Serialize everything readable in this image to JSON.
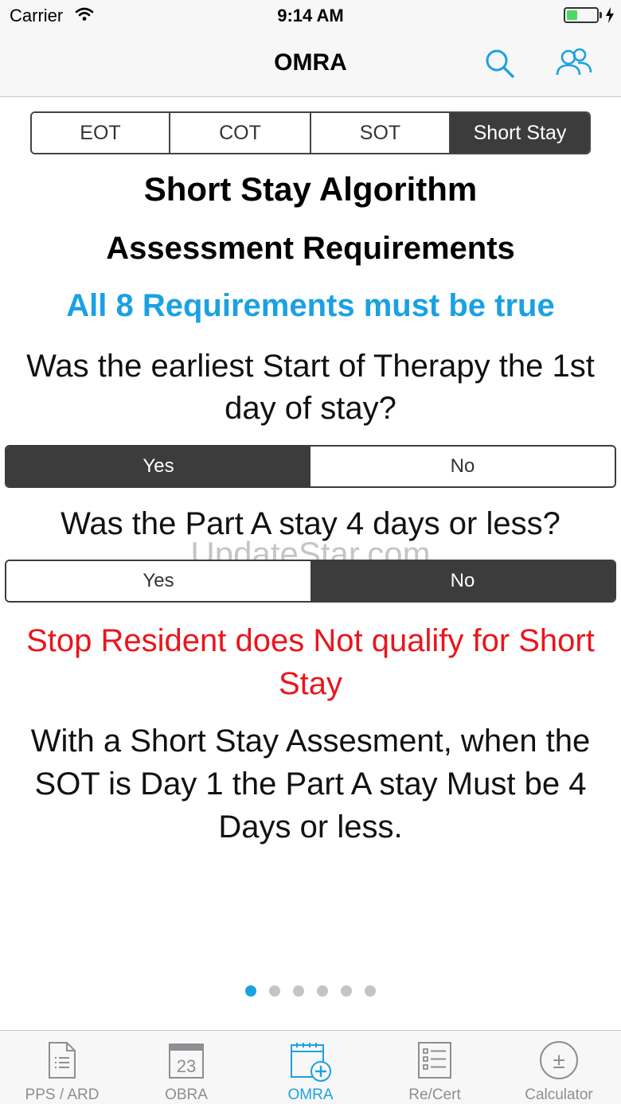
{
  "status_bar": {
    "carrier": "Carrier",
    "time": "9:14 AM",
    "battery_level": 0.35
  },
  "nav": {
    "title": "OMRA",
    "search_icon": "search-icon",
    "users_icon": "users-icon"
  },
  "assessment_tabs": [
    {
      "label": "EOT",
      "active": false
    },
    {
      "label": "COT",
      "active": false
    },
    {
      "label": "SOT",
      "active": false
    },
    {
      "label": "Short Stay",
      "active": true
    }
  ],
  "main": {
    "title": "Short Stay Algorithm",
    "subtitle": "Assessment Requirements",
    "rule": "All 8 Requirements must be true",
    "question1": {
      "text": "Was the earliest Start of Therapy the 1st day of stay?",
      "yes": "Yes",
      "no": "No",
      "selected": "Yes"
    },
    "question2": {
      "text": "Was the Part A stay 4 days or less?",
      "yes": "Yes",
      "no": "No",
      "selected": "No"
    },
    "watermark": "UpdateStar.com",
    "stop_message": "Stop Resident does Not qualify for Short Stay",
    "note": "With a Short Stay Assesment, when the SOT is Day 1 the Part A stay Must be 4 Days or less."
  },
  "pager": {
    "count": 6,
    "current": 1
  },
  "tab_bar": [
    {
      "label": "PPS / ARD",
      "icon": "document-list-icon",
      "active": false
    },
    {
      "label": "OBRA",
      "icon": "calendar-23-icon",
      "calendar_day": "23",
      "active": false
    },
    {
      "label": "OMRA",
      "icon": "calendar-add-icon",
      "active": true
    },
    {
      "label": "Re/Cert",
      "icon": "checklist-icon",
      "active": false
    },
    {
      "label": "Calculator",
      "icon": "calculator-icon",
      "calc_symbol": "±",
      "active": false
    }
  ],
  "colors": {
    "accent": "#1ba1e2",
    "stop": "#e8161c",
    "segment_active": "#3c3c3c",
    "battery": "#4cd964"
  }
}
